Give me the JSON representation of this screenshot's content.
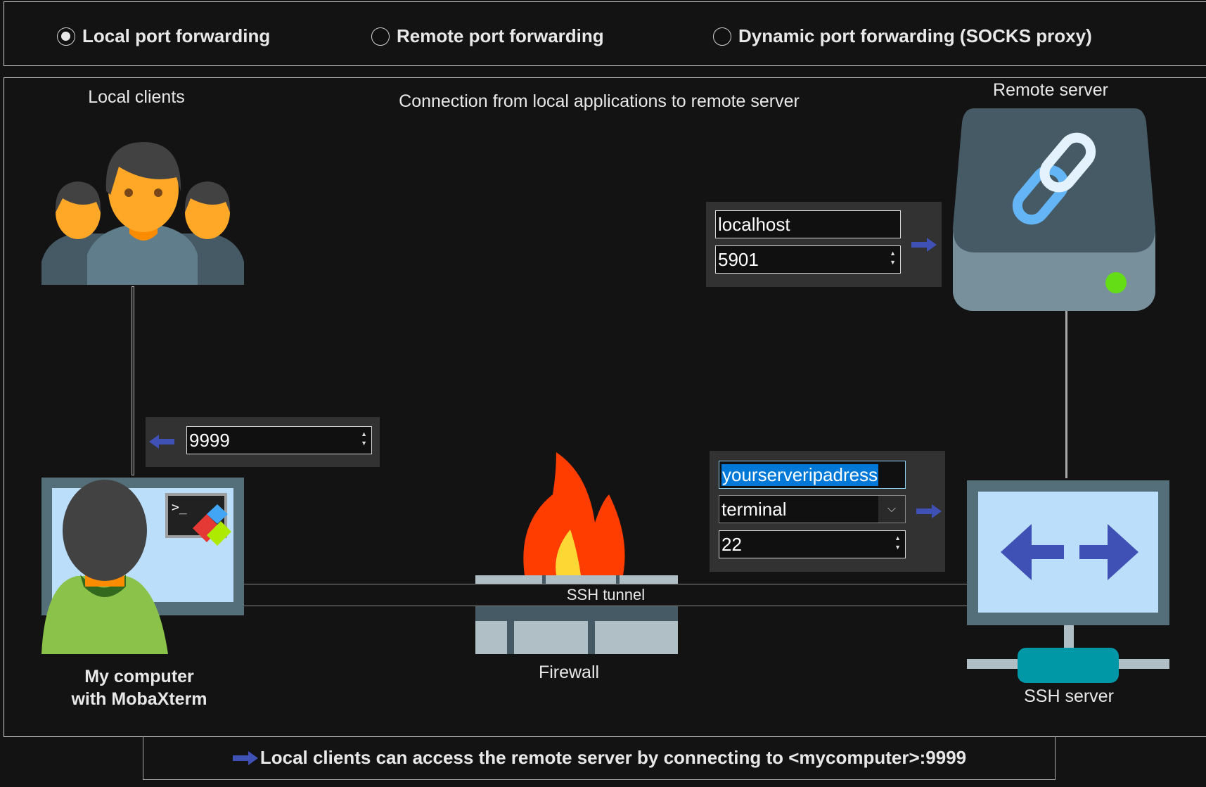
{
  "modes": [
    {
      "label": "Local port forwarding",
      "selected": true
    },
    {
      "label": "Remote port forwarding",
      "selected": false
    },
    {
      "label": "Dynamic port forwarding (SOCKS proxy)",
      "selected": false
    }
  ],
  "diagram": {
    "local_clients": "Local clients",
    "description": "Connection from local applications to remote server",
    "remote_server": "Remote server",
    "my_computer_line1": "My computer",
    "my_computer_line2": "with MobaXterm",
    "firewall": "Firewall",
    "ssh_tunnel": "SSH tunnel",
    "ssh_server": "SSH server"
  },
  "fields": {
    "forwarded_port": "9999",
    "remote_host": "localhost",
    "remote_port": "5901",
    "ssh_server": "yourserveripadress",
    "ssh_user": "terminal",
    "ssh_port": "22"
  },
  "footer": {
    "text": "Local clients can access the remote server by connecting to <mycomputer>:9999"
  },
  "colors": {
    "arrow": "#3f51b5",
    "selection": "#0078d7",
    "panel": "#323232",
    "background": "#131313"
  }
}
